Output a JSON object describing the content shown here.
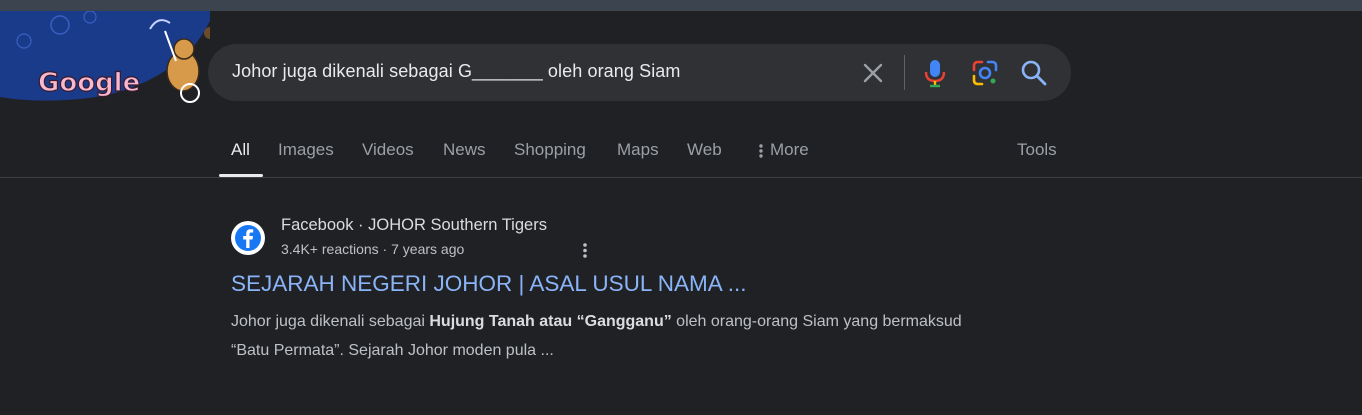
{
  "colors": {
    "background": "#202124",
    "search_box": "#303134",
    "link": "#8ab4f8",
    "text_primary": "#e8eaed",
    "text_secondary": "#bdc1c6",
    "tab_inactive": "#9aa0a6"
  },
  "doodle": {
    "logo_text": "Google",
    "icon": "google-doodle-logo"
  },
  "search": {
    "query": "Johor juga dikenali sebagai G_______ oleh orang Siam",
    "icons": [
      "clear-icon",
      "mic-icon",
      "lens-icon",
      "search-icon"
    ]
  },
  "tabs": {
    "items": [
      {
        "label": "All"
      },
      {
        "label": "Images"
      },
      {
        "label": "Videos"
      },
      {
        "label": "News"
      },
      {
        "label": "Shopping"
      },
      {
        "label": "Maps"
      },
      {
        "label": "Web"
      },
      {
        "label": "More"
      }
    ],
    "active": "All",
    "tools_label": "Tools"
  },
  "result": {
    "favicon": "facebook-icon",
    "site_name": "Facebook · JOHOR Southern Tigers",
    "meta": "3.4K+ reactions · 7 years ago",
    "title": "SEJARAH NEGERI JOHOR | ASAL USUL NAMA ...",
    "snippet": {
      "part1": "Johor juga dikenali sebagai ",
      "bold": "Hujung Tanah atau “Gangganu”",
      "part2": " oleh orang-orang Siam yang bermaksud “Batu Permata”. Sejarah Johor moden pula ..."
    }
  }
}
